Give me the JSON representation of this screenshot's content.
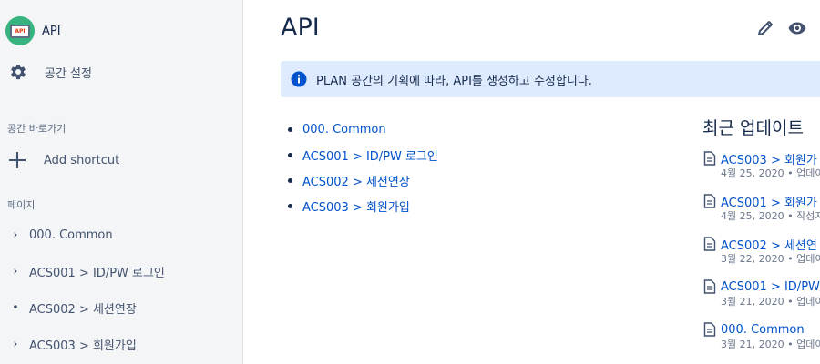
{
  "sidebar": {
    "space_name": "API",
    "space_avatar_text": "API",
    "settings_label": "공간 설정",
    "shortcuts_heading": "공간 바로가기",
    "add_shortcut_label": "Add shortcut",
    "pages_heading": "페이지",
    "pages": [
      {
        "label": "000. Common",
        "toggle": "›",
        "icon": "chevron-right-icon"
      },
      {
        "label": "ACS001 > ID/PW 로그인",
        "toggle": "›",
        "icon": "chevron-right-icon"
      },
      {
        "label": "ACS002 > 세션연장",
        "toggle": "•",
        "icon": "bullet-icon"
      },
      {
        "label": "ACS003 > 회원가입",
        "toggle": "›",
        "icon": "chevron-right-icon"
      }
    ]
  },
  "main": {
    "title": "API",
    "info_text": "PLAN 공간의 기획에 따라, API를 생성하고 수정합니다.",
    "child_pages": [
      "000. Common",
      "ACS001 > ID/PW 로그인",
      "ACS002 > 세션연장",
      "ACS003 > 회원가입"
    ]
  },
  "recent": {
    "title": "최근 업데이트",
    "items": [
      {
        "title": "ACS003 > 회원가",
        "meta": "4월 25, 2020 • 업데이"
      },
      {
        "title": "ACS001 > 회원가",
        "meta": "4월 25, 2020 • 작성지"
      },
      {
        "title": "ACS002 > 세션연",
        "meta": "3월 22, 2020 • 업데이"
      },
      {
        "title": "ACS001 > ID/PW",
        "meta": "3월 21, 2020 • 업데이"
      },
      {
        "title": "000. Common",
        "meta": "3월 21, 2020 • 업데이"
      }
    ]
  },
  "colors": {
    "link": "#0052cc",
    "info_bg": "#deebff",
    "info_icon": "#0052cc",
    "avatar_bg": "#36b37e",
    "sidebar_bg": "#f4f5f7"
  }
}
